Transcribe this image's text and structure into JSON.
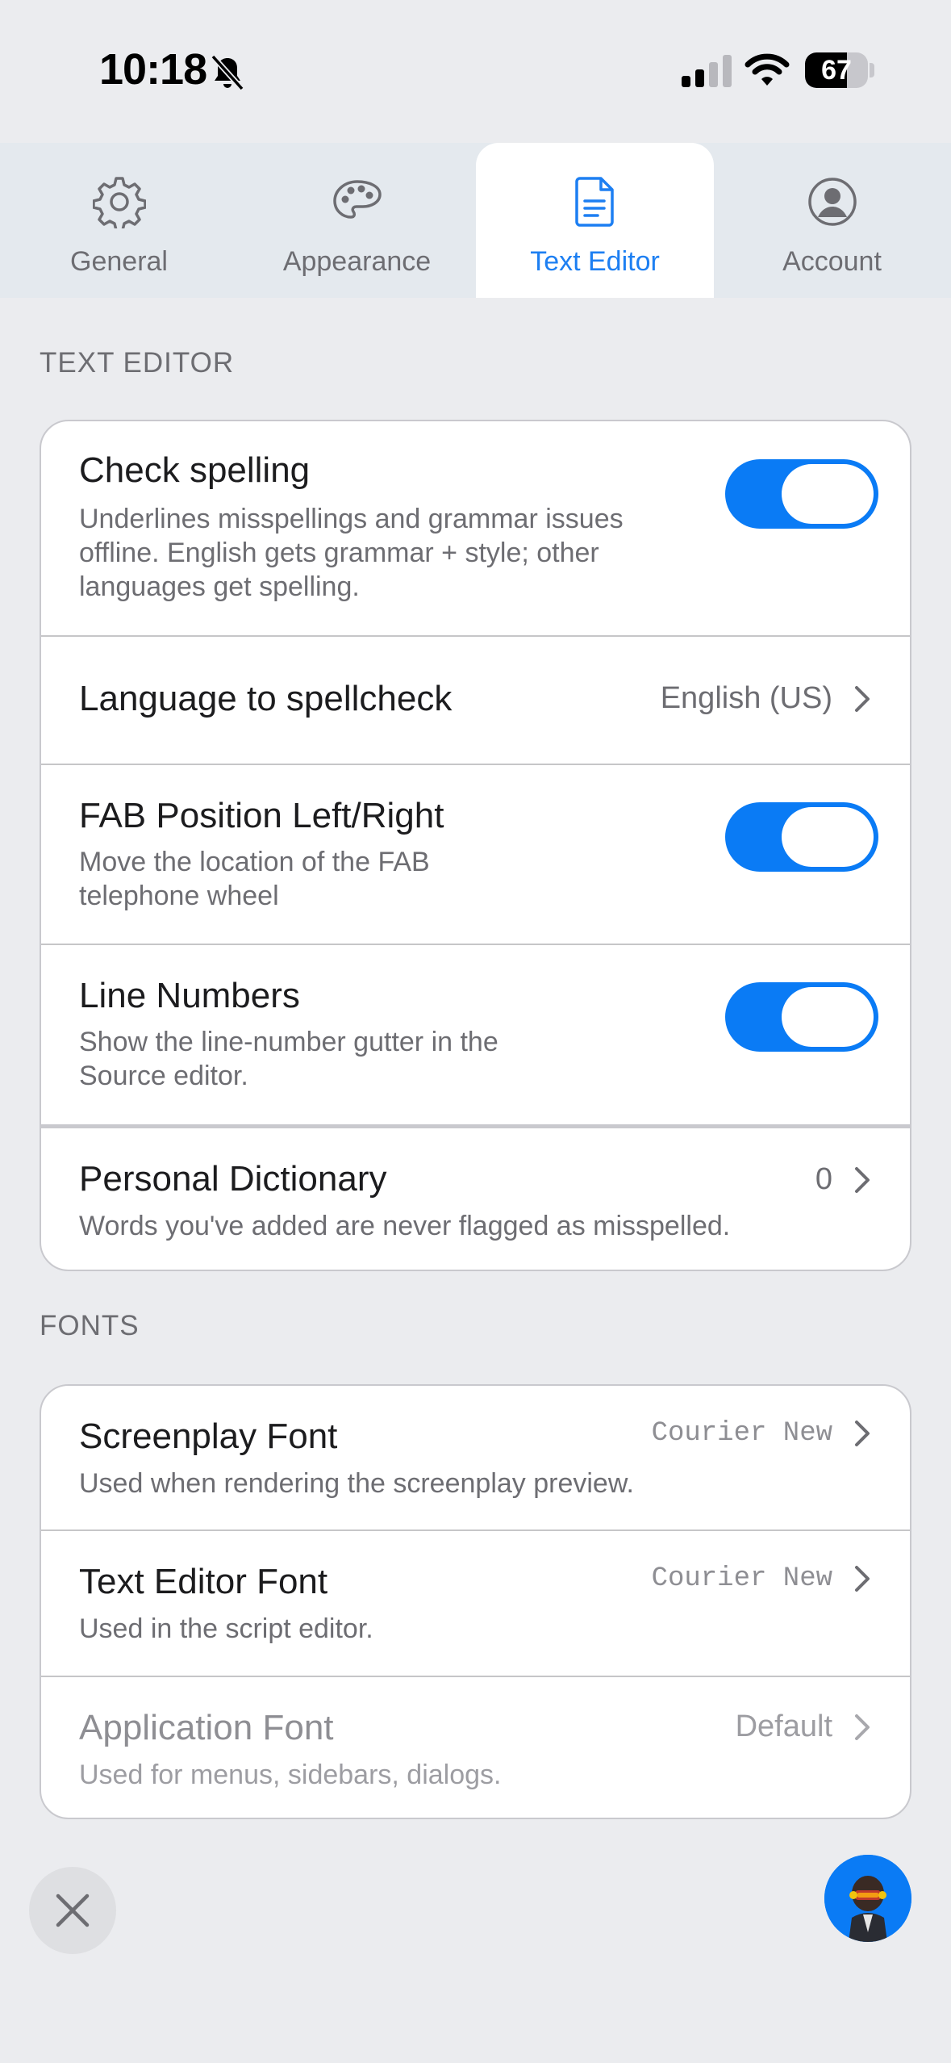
{
  "status_bar": {
    "time": "10:18",
    "battery": "67",
    "battery_level": 0.67
  },
  "tabs": [
    {
      "label": "General",
      "icon": "gear-icon"
    },
    {
      "label": "Appearance",
      "icon": "palette-icon"
    },
    {
      "label": "Text Editor",
      "icon": "document-icon",
      "active": true
    },
    {
      "label": "Account",
      "icon": "person-circle-icon"
    }
  ],
  "text_editor_section": {
    "header": "TEXT EDITOR",
    "check_spelling": {
      "title": "Check spelling",
      "subtitle_lines": [
        "Underlines misspellings and grammar issues",
        "offline. English gets grammar + style; other",
        "languages get spelling."
      ],
      "enabled": true
    },
    "language": {
      "title": "Language to spellcheck",
      "value": "English (US)"
    },
    "fab_position": {
      "title": "FAB Position Left/Right",
      "subtitle_lines": [
        "Move the location of the FAB",
        "telephone wheel"
      ],
      "enabled": true
    },
    "line_numbers": {
      "title": "Line Numbers",
      "subtitle_lines": [
        "Show the line-number gutter in the",
        "Source editor."
      ],
      "enabled": true
    },
    "personal_dictionary": {
      "title": "Personal Dictionary",
      "value": "0",
      "subtitle": "Words you've added are never flagged as misspelled."
    }
  },
  "fonts_section": {
    "header": "FONTS",
    "screenplay_font": {
      "title": "Screenplay Font",
      "value": "Courier New",
      "subtitle": "Used when rendering the screenplay preview."
    },
    "text_editor_font": {
      "title": "Text Editor Font",
      "value": "Courier New",
      "subtitle": "Used in the script editor."
    },
    "application_font": {
      "title": "Application Font",
      "value": "Default",
      "subtitle": "Used for menus, sidebars, dialogs."
    }
  },
  "colors": {
    "accent": "#0a7bf5",
    "background": "#ebecef",
    "tab_bar": "#e4e9ee"
  }
}
